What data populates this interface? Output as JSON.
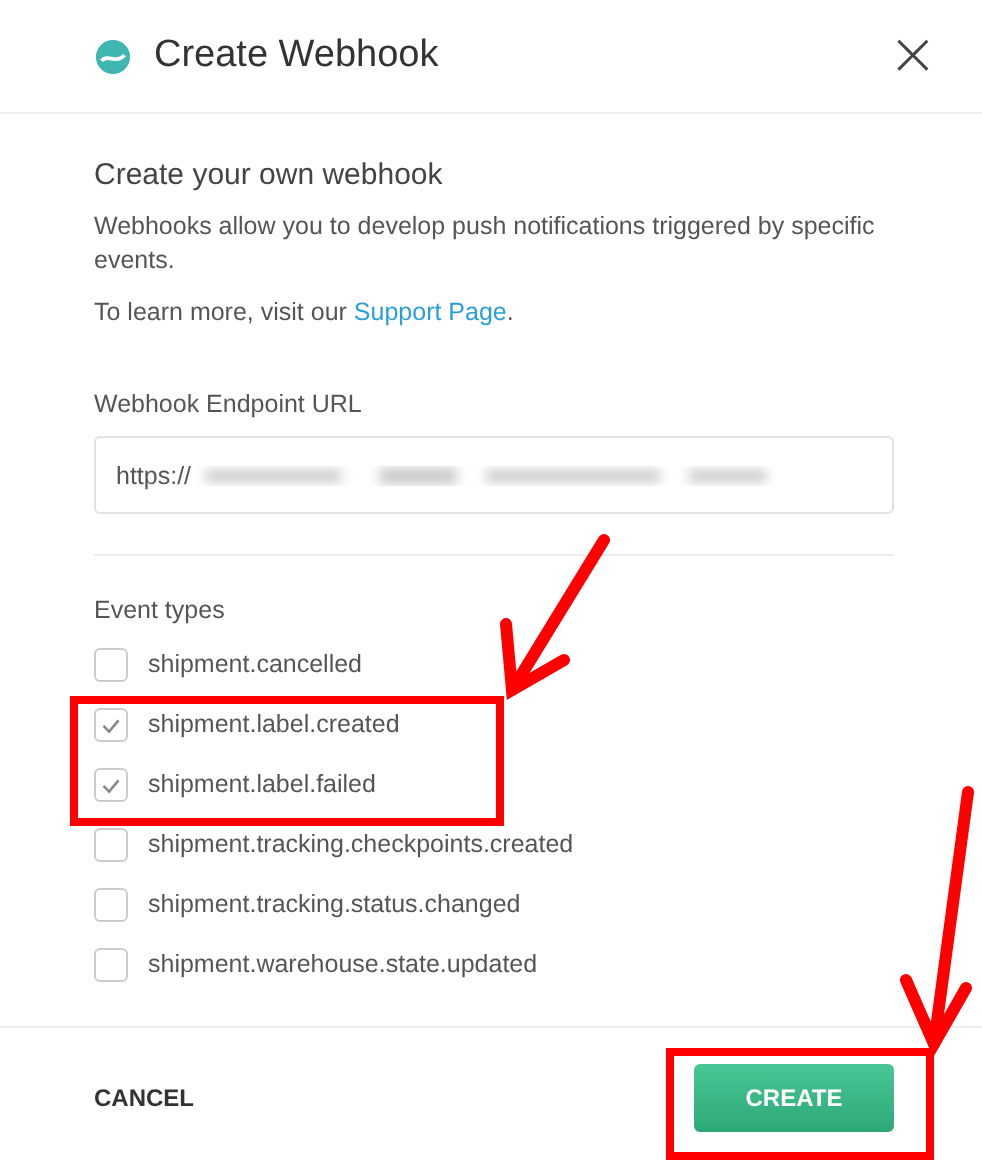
{
  "dialog": {
    "title": "Create Webhook",
    "close": "×"
  },
  "intro": {
    "heading": "Create your own webhook",
    "description": "Webhooks allow you to develop push notifications triggered by specific events.",
    "learn_more": "To learn more, visit our ",
    "link": "Support Page",
    "after_link": "."
  },
  "endpoint": {
    "label": "Webhook Endpoint URL",
    "value": "https://"
  },
  "events": {
    "label": "Event types",
    "items": [
      {
        "name": "shipment.cancelled",
        "checked": false
      },
      {
        "name": "shipment.label.created",
        "checked": true
      },
      {
        "name": "shipment.label.failed",
        "checked": true
      },
      {
        "name": "shipment.tracking.checkpoints.created",
        "checked": false
      },
      {
        "name": "shipment.tracking.status.changed",
        "checked": false
      },
      {
        "name": "shipment.warehouse.state.updated",
        "checked": false
      }
    ]
  },
  "footer": {
    "cancel": "CANCEL",
    "create": "CREATE"
  }
}
